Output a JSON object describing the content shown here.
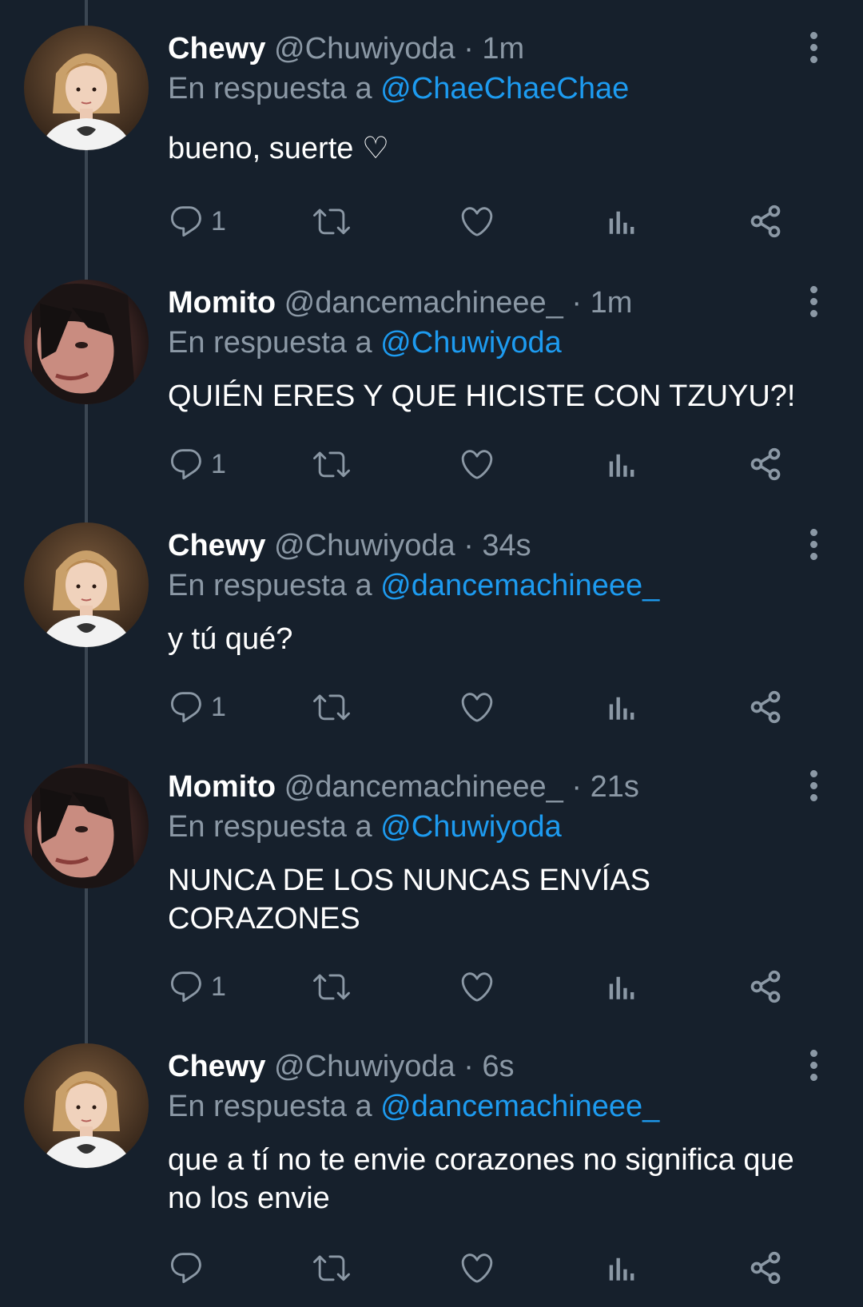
{
  "reply_prefix": "En respuesta a",
  "separator": "·",
  "tweets": [
    {
      "name": "Chewy",
      "handle": "@Chuwiyoda",
      "time": "1m",
      "reply_to": "@ChaeChaeChae",
      "text": "bueno, suerte ♡",
      "reply_count": "1"
    },
    {
      "name": "Momito",
      "handle": "@dancemachineee_",
      "time": "1m",
      "reply_to": "@Chuwiyoda",
      "text": "QUIÉN ERES Y QUE HICISTE CON TZUYU?!",
      "reply_count": "1"
    },
    {
      "name": "Chewy",
      "handle": "@Chuwiyoda",
      "time": "34s",
      "reply_to": "@dancemachineee_",
      "text": "y tú qué?",
      "reply_count": "1"
    },
    {
      "name": "Momito",
      "handle": "@dancemachineee_",
      "time": "21s",
      "reply_to": "@Chuwiyoda",
      "text": "NUNCA DE LOS NUNCAS ENVÍAS CORAZONES",
      "reply_count": "1"
    },
    {
      "name": "Chewy",
      "handle": "@Chuwiyoda",
      "time": "6s",
      "reply_to": "@dancemachineee_",
      "text": "que a tí no te envie corazones no significa que no los envie",
      "reply_count": ""
    }
  ],
  "colors": {
    "background": "#16202c",
    "secondary_text": "#8b98a5",
    "link": "#1d9bf0",
    "thread_line": "#3b4652"
  }
}
